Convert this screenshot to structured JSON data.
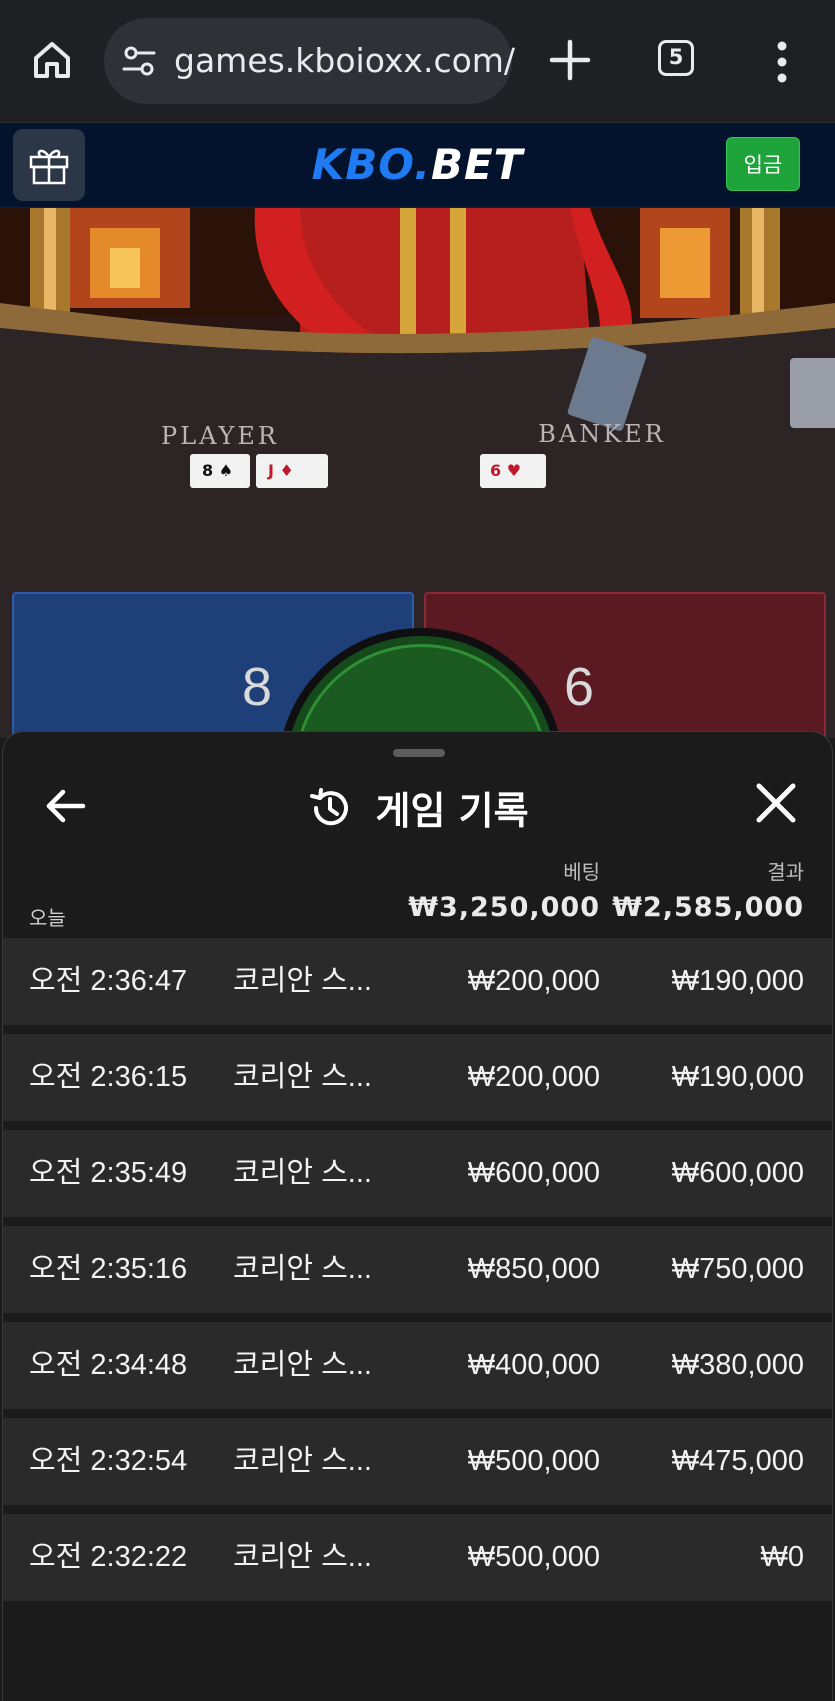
{
  "browser": {
    "url": "games.kboioxx.com/",
    "tab_count": "5"
  },
  "site": {
    "logo_kbo": "KBO",
    "logo_dot": ".",
    "logo_bet": "BET",
    "deposit_label": "입금"
  },
  "game_view": {
    "player_label": "PLAYER",
    "banker_label": "BANKER",
    "player_score": "8",
    "banker_score": "6"
  },
  "history": {
    "title": "게임 기록",
    "bet_header": "베팅",
    "result_header": "결과",
    "today_label": "오늘",
    "total_bet": "₩3,250,000",
    "total_result": "₩2,585,000",
    "rows": [
      {
        "time": "오전 2:36:47",
        "game": "코리안 스...",
        "bet": "₩200,000",
        "result": "₩190,000"
      },
      {
        "time": "오전 2:36:15",
        "game": "코리안 스...",
        "bet": "₩200,000",
        "result": "₩190,000"
      },
      {
        "time": "오전 2:35:49",
        "game": "코리안 스...",
        "bet": "₩600,000",
        "result": "₩600,000"
      },
      {
        "time": "오전 2:35:16",
        "game": "코리안 스...",
        "bet": "₩850,000",
        "result": "₩750,000"
      },
      {
        "time": "오전 2:34:48",
        "game": "코리안 스...",
        "bet": "₩400,000",
        "result": "₩380,000"
      },
      {
        "time": "오전 2:32:54",
        "game": "코리안 스...",
        "bet": "₩500,000",
        "result": "₩475,000"
      },
      {
        "time": "오전 2:32:22",
        "game": "코리안 스...",
        "bet": "₩500,000",
        "result": "₩0"
      }
    ]
  },
  "colors": {
    "brand_blue": "#1e7bf2",
    "deposit_green": "#1fa33b",
    "player_blue": "#1f3f78",
    "banker_red": "#5b1a22",
    "tie_green": "#1b5a20"
  },
  "icons": {
    "home": "home-icon",
    "site_info": "tune-icon",
    "new_tab": "plus-icon",
    "tabs": "tab-switcher-icon",
    "menu": "more-vertical-icon",
    "gift": "gift-icon",
    "back": "arrow-left-icon",
    "history": "history-icon",
    "close": "close-icon"
  }
}
